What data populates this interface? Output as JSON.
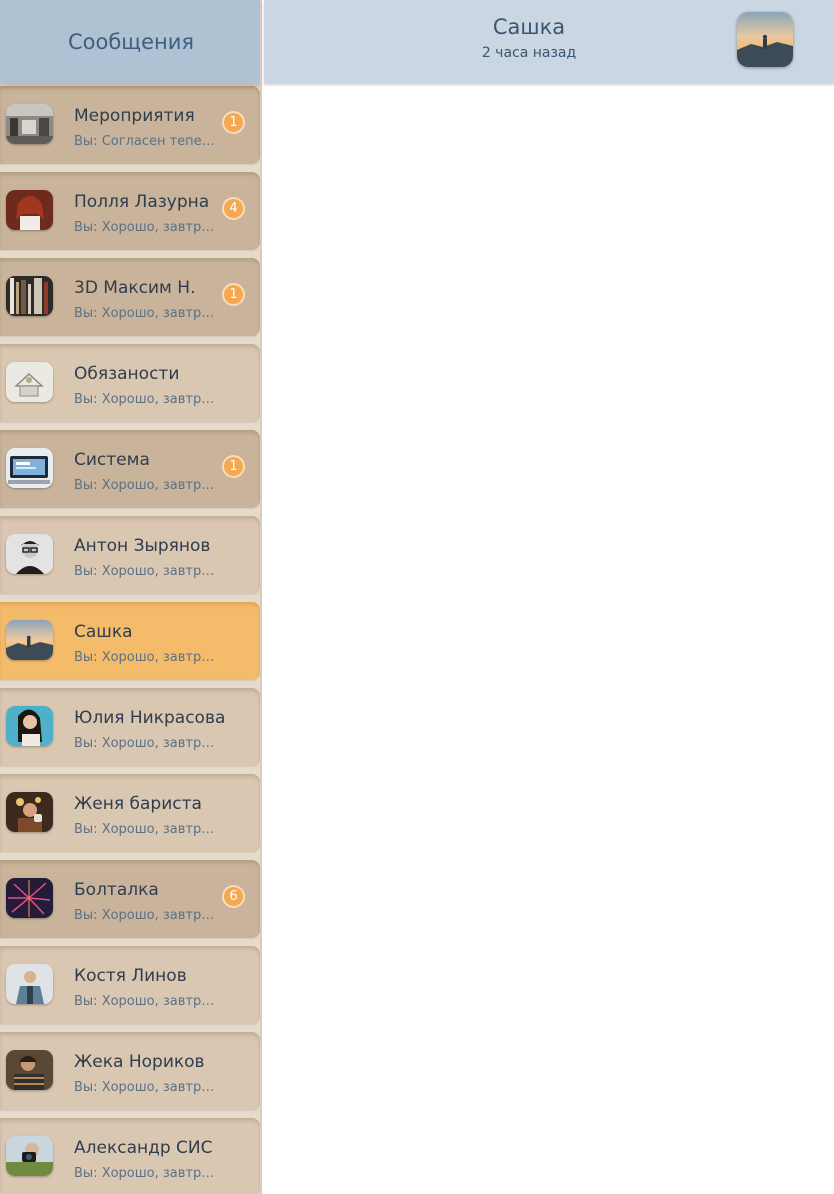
{
  "sidebar": {
    "title": "Сообщения",
    "conversations": [
      {
        "name": "Мероприятия",
        "preview": "Вы: Согласен теперь...",
        "badge": "1",
        "unread": true,
        "active": false,
        "avatar_icon": "office-interior-photo"
      },
      {
        "name": "Полля Лазурна",
        "preview": "Вы: Хорошо, завтра...",
        "badge": "4",
        "unread": true,
        "active": false,
        "avatar_icon": "woman-red-hair-photo"
      },
      {
        "name": "3D Максим Н.",
        "preview": "Вы: Хорошо, завтра...",
        "badge": "1",
        "unread": true,
        "active": false,
        "avatar_icon": "bookshelf-photo"
      },
      {
        "name": "Обязаности",
        "preview": "Вы: Хорошо, завтра...",
        "badge": "",
        "unread": false,
        "active": false,
        "avatar_icon": "sketch-house-photo"
      },
      {
        "name": "Система",
        "preview": "Вы: Хорошо, завтра...",
        "badge": "1",
        "unread": true,
        "active": false,
        "avatar_icon": "computer-screen-photo"
      },
      {
        "name": "Антон Зырянов",
        "preview": "Вы: Хорошо, завтра...",
        "badge": "",
        "unread": false,
        "active": false,
        "avatar_icon": "man-glasses-photo"
      },
      {
        "name": "Сашка",
        "preview": "Вы: Хорошо, завтра...",
        "badge": "",
        "unread": false,
        "active": true,
        "avatar_icon": "mountain-sunset-photo"
      },
      {
        "name": "Юлия Никрасова",
        "preview": "Вы: Хорошо, завтра...",
        "badge": "",
        "unread": false,
        "active": false,
        "avatar_icon": "woman-dark-hair-photo"
      },
      {
        "name": "Женя бариста",
        "preview": "Вы: Хорошо, завтра...",
        "badge": "",
        "unread": false,
        "active": false,
        "avatar_icon": "barista-photo"
      },
      {
        "name": "Болталка",
        "preview": "Вы: Хорошо, завтра...",
        "badge": "6",
        "unread": true,
        "active": false,
        "avatar_icon": "fireworks-photo"
      },
      {
        "name": "Костя Линов",
        "preview": "Вы: Хорошо, завтра...",
        "badge": "",
        "unread": false,
        "active": false,
        "avatar_icon": "man-denim-photo"
      },
      {
        "name": "Жека Нориков",
        "preview": "Вы: Хорошо, завтра...",
        "badge": "",
        "unread": false,
        "active": false,
        "avatar_icon": "man-striped-shirt-photo"
      },
      {
        "name": "Александр СИС",
        "preview": "Вы: Хорошо, завтра...",
        "badge": "",
        "unread": false,
        "active": false,
        "avatar_icon": "camera-photographer-photo"
      }
    ]
  },
  "chat": {
    "name": "Сашка",
    "status": "2 часа назад",
    "avatar_icon": "mountain-sunset-photo"
  },
  "colors": {
    "sidebar_header": "#afc2d4",
    "chat_header": "#cad6e2",
    "item_read": "#dac7b2",
    "item_unread": "#c9b49b",
    "item_active": "#f4bb6b",
    "badge": "#f4a851"
  }
}
